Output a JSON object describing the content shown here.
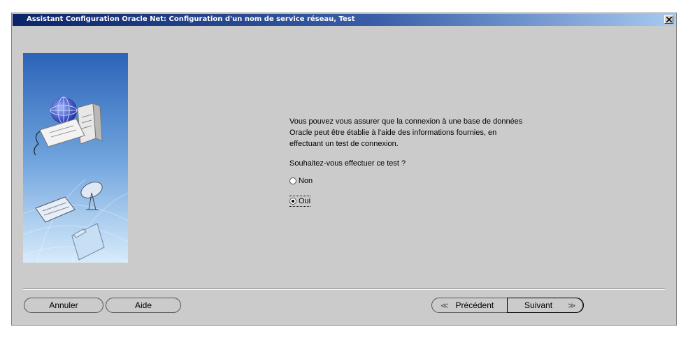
{
  "dialog": {
    "title": "Assistant Configuration Oracle Net: Configuration d'un nom de service réseau, Test"
  },
  "content": {
    "description": "Vous pouvez vous assurer que la connexion à une base de données Oracle peut être établie à l'aide des informations fournies, en effectuant un test de connexion.",
    "question": "Souhaitez-vous effectuer ce test ?",
    "options": [
      {
        "label": "Non",
        "selected": false
      },
      {
        "label": "Oui",
        "selected": true
      }
    ]
  },
  "buttons": {
    "cancel": "Annuler",
    "help": "Aide",
    "previous": "Précédent",
    "next": "Suivant"
  },
  "icons": {
    "close": "close-icon",
    "previous": "chevron-left-icon",
    "next": "chevron-right-icon"
  }
}
